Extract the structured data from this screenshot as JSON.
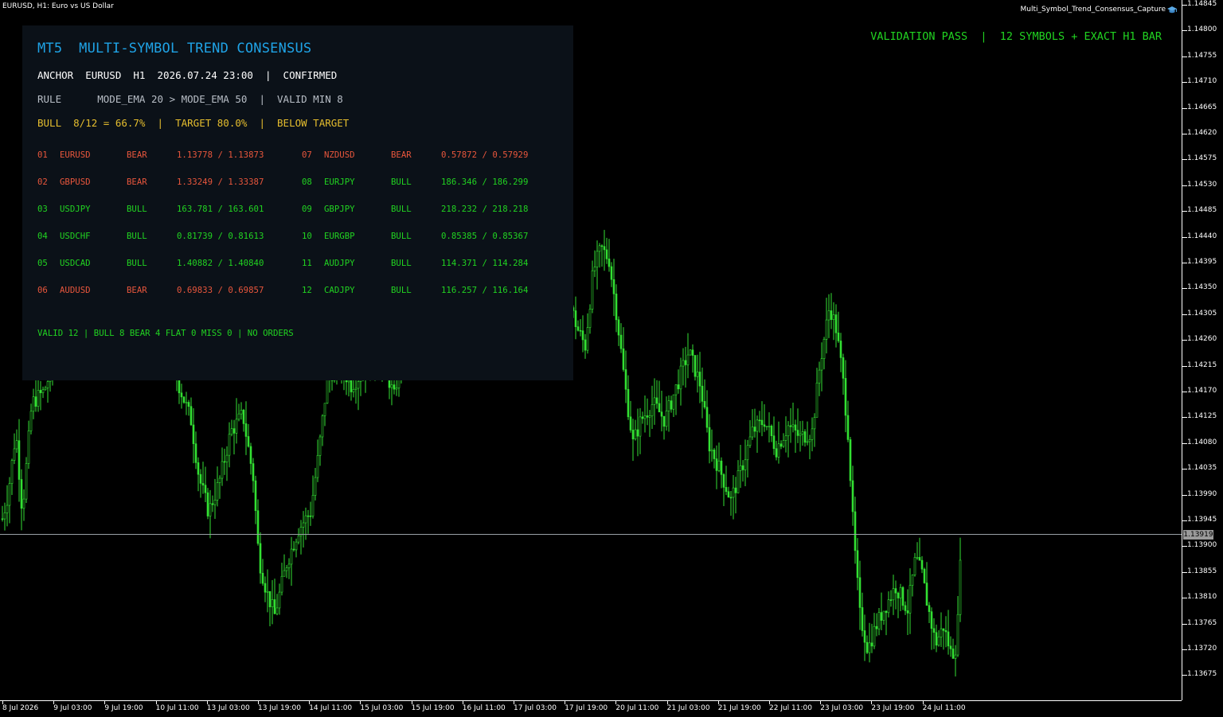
{
  "window": {
    "caption": "EURUSD, H1:  Euro vs US Dollar",
    "program": "Multi_Symbol_Trend_Consensus_Capture",
    "program_icon": "graduation-cap-icon"
  },
  "validation": "VALIDATION PASS  |  12 SYMBOLS + EXACT H1 BAR",
  "colors": {
    "bull": "#21d321",
    "bear": "#e8563c",
    "accent": "#1fa3e6",
    "warn": "#e6be2e",
    "panel": "#0b1118",
    "candle": "#33e033"
  },
  "panel": {
    "title": "MT5  MULTI-SYMBOL TREND CONSENSUS",
    "anchor": "ANCHOR  EURUSD  H1  2026.07.24 23:00  |  CONFIRMED",
    "rule": "RULE      MODE_EMA 20 > MODE_EMA 50  |  VALID MIN 8",
    "bull": "BULL  8/12 = 66.7%  |  TARGET 80.0%  |  BELOW TARGET",
    "left_rows": [
      {
        "num": "01",
        "symbol": "EURUSD",
        "trend": "BEAR",
        "ema": "1.13778 / 1.13873"
      },
      {
        "num": "02",
        "symbol": "GBPUSD",
        "trend": "BEAR",
        "ema": "1.33249 / 1.33387"
      },
      {
        "num": "03",
        "symbol": "USDJPY",
        "trend": "BULL",
        "ema": "163.781 / 163.601"
      },
      {
        "num": "04",
        "symbol": "USDCHF",
        "trend": "BULL",
        "ema": "0.81739 / 0.81613"
      },
      {
        "num": "05",
        "symbol": "USDCAD",
        "trend": "BULL",
        "ema": "1.40882 / 1.40840"
      },
      {
        "num": "06",
        "symbol": "AUDUSD",
        "trend": "BEAR",
        "ema": "0.69833 / 0.69857"
      }
    ],
    "right_rows": [
      {
        "num": "07",
        "symbol": "NZDUSD",
        "trend": "BEAR",
        "ema": "0.57872 / 0.57929"
      },
      {
        "num": "08",
        "symbol": "EURJPY",
        "trend": "BULL",
        "ema": "186.346 / 186.299"
      },
      {
        "num": "09",
        "symbol": "GBPJPY",
        "trend": "BULL",
        "ema": "218.232 / 218.218"
      },
      {
        "num": "10",
        "symbol": "EURGBP",
        "trend": "BULL",
        "ema": "0.85385 / 0.85367"
      },
      {
        "num": "11",
        "symbol": "AUDJPY",
        "trend": "BULL",
        "ema": "114.371 / 114.284"
      },
      {
        "num": "12",
        "symbol": "CADJPY",
        "trend": "BULL",
        "ema": "116.257 / 116.164"
      }
    ],
    "footer": "VALID 12 | BULL 8 BEAR 4 FLAT 0 MISS 0 | NO ORDERS"
  },
  "price_axis": {
    "labels": [
      "1.14845",
      "1.14800",
      "1.14755",
      "1.14710",
      "1.14665",
      "1.14620",
      "1.14575",
      "1.14530",
      "1.14485",
      "1.14440",
      "1.14395",
      "1.14350",
      "1.14305",
      "1.14260",
      "1.14215",
      "1.14170",
      "1.14125",
      "1.14080",
      "1.14035",
      "1.13990",
      "1.13945",
      "1.13900",
      "1.13855",
      "1.13810",
      "1.13765",
      "1.13720",
      "1.13675"
    ],
    "current": "1.13919"
  },
  "time_axis": {
    "labels": [
      "8 Jul 2026",
      "9 Jul 03:00",
      "9 Jul 19:00",
      "10 Jul 11:00",
      "13 Jul 03:00",
      "13 Jul 19:00",
      "14 Jul 11:00",
      "15 Jul 03:00",
      "15 Jul 19:00",
      "16 Jul 11:00",
      "17 Jul 03:00",
      "17 Jul 19:00",
      "20 Jul 11:00",
      "21 Jul 03:00",
      "21 Jul 19:00",
      "22 Jul 11:00",
      "23 Jul 03:00",
      "23 Jul 19:00",
      "24 Jul 11:00"
    ]
  },
  "chart_data": {
    "type": "candlestick",
    "symbol": "EURUSD",
    "timeframe": "H1",
    "ylim": [
      1.1365,
      1.1485
    ],
    "path": [
      [
        0,
        1.1393
      ],
      [
        10,
        1.1399
      ],
      [
        20,
        1.141
      ],
      [
        28,
        1.1396
      ],
      [
        40,
        1.1415
      ],
      [
        55,
        1.1417
      ],
      [
        70,
        1.1423
      ],
      [
        90,
        1.143
      ],
      [
        110,
        1.1425
      ],
      [
        130,
        1.1432
      ],
      [
        150,
        1.1428
      ],
      [
        170,
        1.1433
      ],
      [
        190,
        1.1429
      ],
      [
        210,
        1.1426
      ],
      [
        225,
        1.1418
      ],
      [
        240,
        1.1412
      ],
      [
        250,
        1.1402
      ],
      [
        262,
        1.1396
      ],
      [
        275,
        1.1401
      ],
      [
        290,
        1.141
      ],
      [
        305,
        1.1413
      ],
      [
        318,
        1.1402
      ],
      [
        325,
        1.1388
      ],
      [
        335,
        1.1382
      ],
      [
        345,
        1.1378
      ],
      [
        360,
        1.1387
      ],
      [
        375,
        1.1393
      ],
      [
        390,
        1.1396
      ],
      [
        400,
        1.1406
      ],
      [
        410,
        1.1418
      ],
      [
        425,
        1.1423
      ],
      [
        440,
        1.1418
      ],
      [
        460,
        1.1421
      ],
      [
        480,
        1.1423
      ],
      [
        495,
        1.1416
      ],
      [
        510,
        1.1429
      ],
      [
        525,
        1.1438
      ],
      [
        545,
        1.1433
      ],
      [
        565,
        1.1428
      ],
      [
        590,
        1.1431
      ],
      [
        615,
        1.1425
      ],
      [
        640,
        1.1428
      ],
      [
        665,
        1.143
      ],
      [
        690,
        1.1426
      ],
      [
        710,
        1.1435
      ],
      [
        725,
        1.1428
      ],
      [
        735,
        1.1425
      ],
      [
        745,
        1.1438
      ],
      [
        755,
        1.1442
      ],
      [
        765,
        1.144
      ],
      [
        775,
        1.143
      ],
      [
        785,
        1.1418
      ],
      [
        795,
        1.1408
      ],
      [
        805,
        1.1412
      ],
      [
        820,
        1.1415
      ],
      [
        835,
        1.1412
      ],
      [
        850,
        1.1418
      ],
      [
        865,
        1.1424
      ],
      [
        880,
        1.1418
      ],
      [
        890,
        1.1408
      ],
      [
        905,
        1.1403
      ],
      [
        918,
        1.1398
      ],
      [
        930,
        1.1403
      ],
      [
        945,
        1.141
      ],
      [
        960,
        1.1412
      ],
      [
        975,
        1.1407
      ],
      [
        990,
        1.1411
      ],
      [
        1005,
        1.1409
      ],
      [
        1020,
        1.141
      ],
      [
        1030,
        1.1422
      ],
      [
        1042,
        1.1432
      ],
      [
        1050,
        1.1428
      ],
      [
        1058,
        1.142
      ],
      [
        1065,
        1.141
      ],
      [
        1072,
        1.1392
      ],
      [
        1080,
        1.1378
      ],
      [
        1090,
        1.1372
      ],
      [
        1100,
        1.1376
      ],
      [
        1110,
        1.1379
      ],
      [
        1125,
        1.1383
      ],
      [
        1140,
        1.1379
      ],
      [
        1150,
        1.1388
      ],
      [
        1158,
        1.1385
      ],
      [
        1166,
        1.1379
      ],
      [
        1175,
        1.1373
      ],
      [
        1185,
        1.1376
      ],
      [
        1195,
        1.1371
      ],
      [
        1202,
        1.1373
      ],
      [
        1207,
        1.1393
      ]
    ]
  }
}
